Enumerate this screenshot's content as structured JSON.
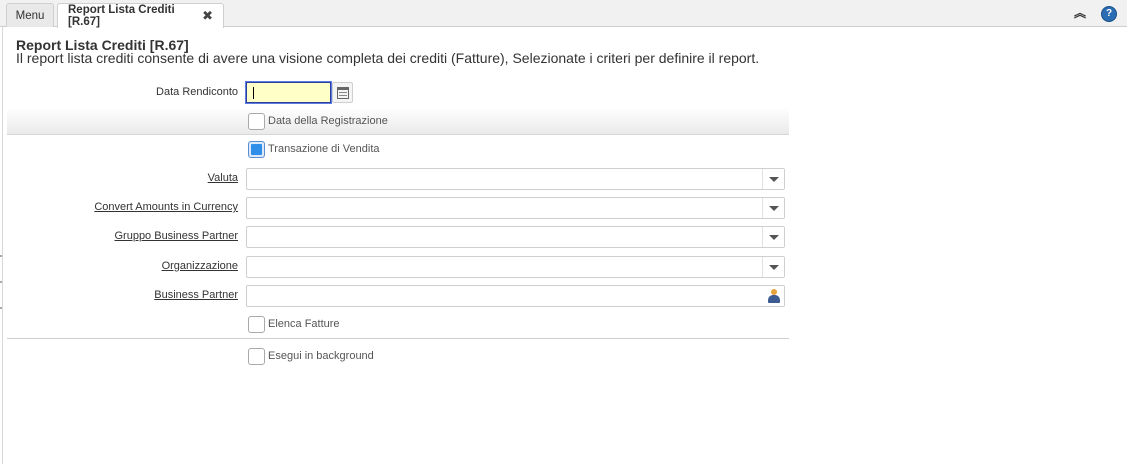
{
  "tabs": {
    "menu_label": "Menu",
    "active_label": "Report Lista Crediti [R.67]",
    "close_glyph": "✖"
  },
  "toolbar": {
    "collapse_glyph": "︽",
    "help_glyph": "?"
  },
  "header": {
    "title": "Report Lista Crediti [R.67]",
    "description": "Il report lista crediti consente di avere una visione completa dei crediti (Fatture), Selezionate i criteri per definire il report."
  },
  "form": {
    "data_rendiconto_label": "Data Rendiconto",
    "data_rendiconto_value": "",
    "data_registrazione_label": "Data della Registrazione",
    "data_registrazione_checked": false,
    "transazione_vendita_label": "Transazione di Vendita",
    "transazione_vendita_checked": true,
    "valuta_label": "Valuta",
    "valuta_value": "",
    "convert_label": "Convert Amounts in Currency",
    "convert_value": "",
    "gruppo_bp_label": "Gruppo Business Partner",
    "gruppo_bp_value": "",
    "organizzazione_label": "Organizzazione",
    "organizzazione_value": "",
    "business_partner_label": "Business Partner",
    "business_partner_value": "",
    "elenca_fatture_label": "Elenca Fatture",
    "elenca_fatture_checked": false,
    "esegui_background_label": "Esegui in background",
    "esegui_background_checked": false
  },
  "icons": {
    "calendar": "calendar-icon",
    "dropdown": "chevron-down-icon",
    "business_partner": "person-icon",
    "help": "help-icon",
    "collapse": "double-chevron-up-icon",
    "close": "close-icon"
  },
  "colors": {
    "focused_field_bg": "#ffffc8",
    "checkbox_on": "#2f8ee8",
    "help_icon": "#2a6db3"
  }
}
